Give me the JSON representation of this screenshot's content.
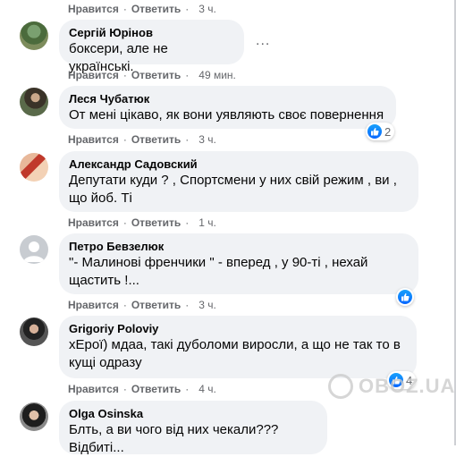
{
  "comments": [
    {
      "author": "",
      "text": "",
      "like_label": "Нравится",
      "reply_label": "Ответить",
      "time": "3 ч."
    },
    {
      "author": "Сергій Юрінов",
      "text": "боксери, але не українські.",
      "like_label": "Нравится",
      "reply_label": "Ответить",
      "time": "49 мин.",
      "more_options": "..."
    },
    {
      "author": "Леся Чубатюк",
      "text": "От мені цікаво, як вони уявляють своє повернення",
      "like_label": "Нравится",
      "reply_label": "Ответить",
      "time": "3 ч.",
      "reaction_count": "2"
    },
    {
      "author": "Александр Садовский",
      "text": "Депутати куди ? , Спортсмени у них свій режим , ви ,\nщо йоб. Ті",
      "like_label": "Нравится",
      "reply_label": "Ответить",
      "time": "1 ч."
    },
    {
      "author": "Петро Бевзелюк",
      "text": "\"- Малинові френчики \" - вперед , у 90-ті , нехай\nщастить !...",
      "like_label": "Нравится",
      "reply_label": "Ответить",
      "time": "3 ч."
    },
    {
      "author": "Grigoriy Poloviy",
      "text": "хЕрої) мдаа, такі дуболоми виросли, а що не так то в\nкущі одразу",
      "like_label": "Нравится",
      "reply_label": "Ответить",
      "time": "4 ч.",
      "reaction_count": "4"
    },
    {
      "author": "Olga Osinska",
      "text": "Блть, а ви чого від них чекали??? Відбиті..."
    }
  ],
  "watermark": "OBOZ.UA",
  "colors": {
    "bubble": "#f0f2f5",
    "meta_text": "#65676b",
    "like_blue": "#0866ff"
  },
  "icons": [
    "like-thumb-icon",
    "more-options-icon"
  ]
}
